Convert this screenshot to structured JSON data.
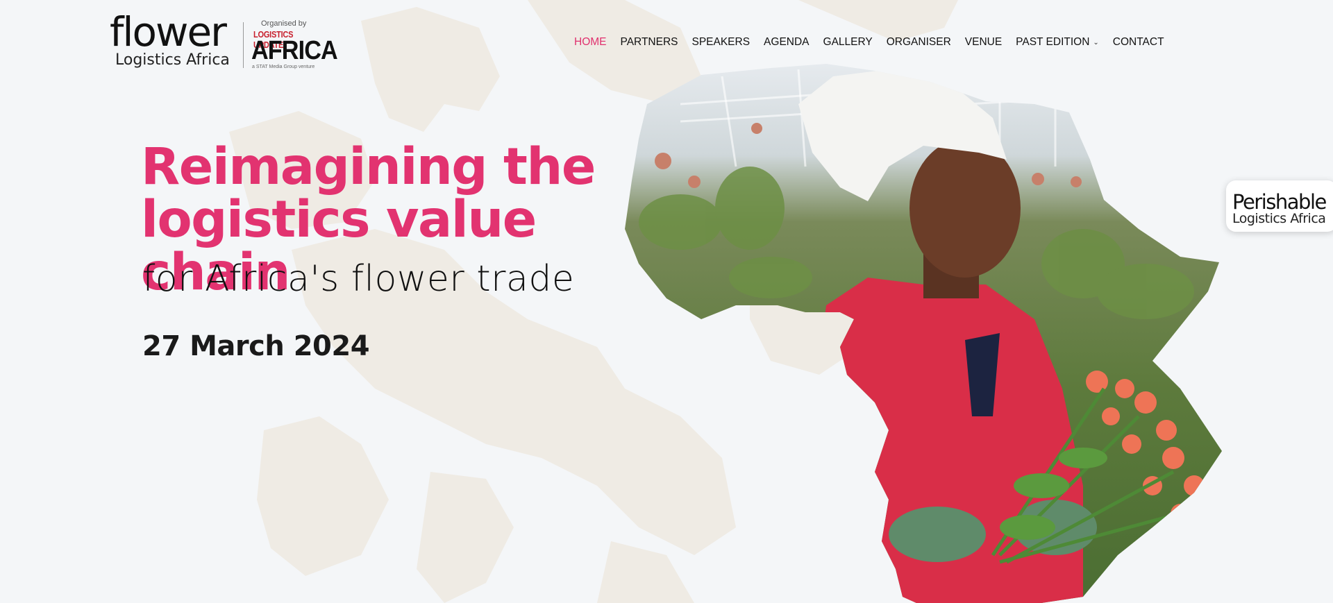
{
  "colors": {
    "accent": "#e23370",
    "background": "#f4f6f8",
    "map_shape": "#efebe4",
    "text": "#111111"
  },
  "logo": {
    "flower_text": "flower",
    "sub_text": "Logistics Africa",
    "organised_by": "Organised by",
    "logistics_update": "LOGISTICS UPDATE",
    "africa": "AFRICA",
    "tagline": "a STAT Media Group venture"
  },
  "nav": {
    "items": [
      {
        "label": "HOME",
        "active": true
      },
      {
        "label": "PARTNERS"
      },
      {
        "label": "SPEAKERS"
      },
      {
        "label": "AGENDA"
      },
      {
        "label": "GALLERY"
      },
      {
        "label": "ORGANISER"
      },
      {
        "label": "VENUE"
      },
      {
        "label": "PAST EDITION",
        "dropdown": true
      },
      {
        "label": "CONTACT"
      }
    ]
  },
  "hero": {
    "title_line1": "Reimagining the",
    "title_line2": "logistics value chain",
    "subtitle": "for Africa's flower trade",
    "date": "27 March 2024"
  },
  "badge": {
    "line1": "Perishable",
    "line2": "Logistics Africa"
  }
}
